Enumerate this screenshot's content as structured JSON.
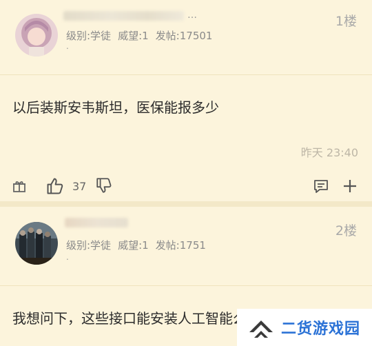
{
  "posts": [
    {
      "name_visible": "…",
      "meta": {
        "level": "级别:学徒",
        "prestige": "威望:1",
        "post_count": "发帖:17501"
      },
      "dot": ".",
      "floor": "1楼",
      "content": "以后装斯安韦斯坦，医保能报多少",
      "time": "昨天 23:40",
      "likes": "37"
    },
    {
      "meta": {
        "level": "级别:学徒",
        "prestige": "威望:1",
        "post_count": "发帖:1751"
      },
      "dot": ".",
      "floor": "2楼",
      "content": "我想问下，这些接口能安装人工智能么?"
    }
  ],
  "watermark": {
    "text": "二货游戏园"
  }
}
